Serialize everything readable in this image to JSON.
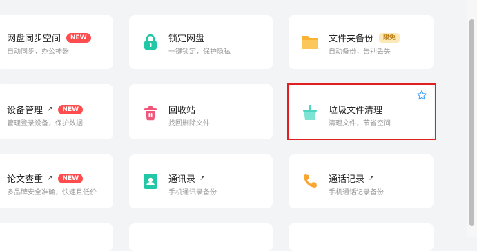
{
  "cards": [
    {
      "title": "网盘同步空间",
      "desc": "自动同步，办公神器",
      "badge": "NEW",
      "badge_type": "new",
      "icon": "sync-icon"
    },
    {
      "title": "锁定网盘",
      "desc": "一键锁定，保护隐私",
      "icon": "lock-icon"
    },
    {
      "title": "文件夹备份",
      "desc": "自动备份，告别丢失",
      "badge": "限免",
      "badge_type": "free",
      "icon": "folder-icon"
    },
    {
      "title": "设备管理",
      "desc": "管理登录设备，保护数据",
      "badge": "NEW",
      "badge_type": "new",
      "arrow": "↗",
      "icon": "device-icon"
    },
    {
      "title": "回收站",
      "desc": "找回删除文件",
      "icon": "recycle-bin-icon"
    },
    {
      "title": "垃圾文件清理",
      "desc": "清理文件，节省空间",
      "icon": "cleanup-icon"
    },
    {
      "title": "论文查重",
      "desc": "多品牌安全准确，快速且低价",
      "badge": "NEW",
      "badge_type": "new",
      "arrow": "↗",
      "icon": "paper-check-icon"
    },
    {
      "title": "通讯录",
      "desc": "手机通讯录备份",
      "arrow": "↗",
      "icon": "contacts-icon"
    },
    {
      "title": "通话记录",
      "desc": "手机通话记录备份",
      "arrow": "↗",
      "icon": "phone-icon"
    }
  ],
  "colors": {
    "accent_red": "#e02020",
    "new_badge": "#ff4d4f",
    "free_badge": "#fde8b8"
  }
}
